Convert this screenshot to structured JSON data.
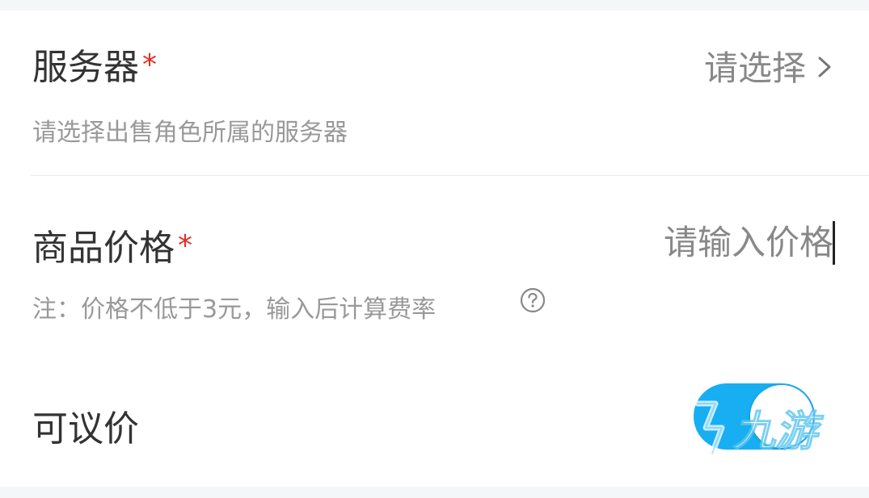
{
  "server": {
    "label": "服务器",
    "required_mark": "*",
    "value": "请选择",
    "hint": "请选择出售角色所属的服务器"
  },
  "price": {
    "label": "商品价格",
    "required_mark": "*",
    "placeholder": "请输入价格",
    "value": "",
    "hint": "注：价格不低于3元，输入后计算费率"
  },
  "negotiable": {
    "label": "可议价",
    "enabled": true
  },
  "watermark": {
    "text": "九游"
  },
  "colors": {
    "required": "#e02e24",
    "toggle_on": "#18aef2",
    "label": "#333333",
    "hint": "#999999"
  },
  "icons": {
    "chevron": "chevron-right-icon",
    "help": "question-circle-icon"
  }
}
